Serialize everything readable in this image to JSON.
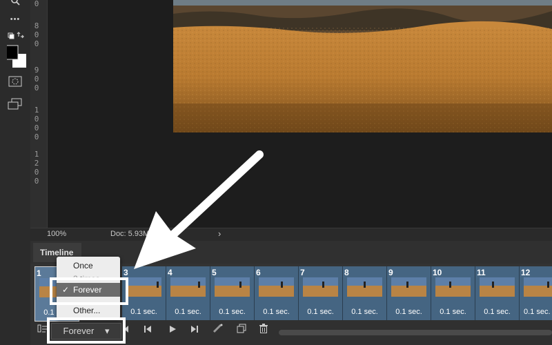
{
  "toolbar": {
    "tools": [
      {
        "icon": "zoom-icon"
      },
      {
        "icon": "more-tools-icon",
        "glyph": "•••"
      },
      {
        "icon": "swap-colors-icon"
      },
      {
        "icon": "color-swatches-icon"
      },
      {
        "icon": "quick-mask-icon"
      },
      {
        "icon": "screen-mode-icon"
      }
    ]
  },
  "ruler": {
    "digits": [
      "0",
      "8",
      "0",
      "0",
      "9",
      "0",
      "0",
      "1",
      "0",
      "0",
      "0",
      "1",
      "2",
      "0",
      "0"
    ]
  },
  "status": {
    "zoom": "100%",
    "doc": "Doc: 5.93M/5.93M",
    "arrow": "›"
  },
  "timeline": {
    "tab_label": "Timeline",
    "frames": [
      {
        "number": "1",
        "duration": "0.1 sec."
      },
      {
        "number": "3",
        "duration": "0.1 sec."
      },
      {
        "number": "4",
        "duration": "0.1 sec."
      },
      {
        "number": "5",
        "duration": "0.1 sec."
      },
      {
        "number": "6",
        "duration": "0.1 sec."
      },
      {
        "number": "7",
        "duration": "0.1 sec."
      },
      {
        "number": "8",
        "duration": "0.1 sec."
      },
      {
        "number": "9",
        "duration": "0.1 sec."
      },
      {
        "number": "10",
        "duration": "0.1 sec."
      },
      {
        "number": "11",
        "duration": "0.1 sec."
      },
      {
        "number": "12",
        "duration": "0.1 sec."
      }
    ],
    "loop_select": {
      "value": "Forever",
      "caret": "▾"
    },
    "loop_menu": {
      "options": [
        "Once",
        "3 times",
        "Forever",
        "Other..."
      ],
      "selected": "Forever",
      "check": "✓"
    }
  },
  "colors": {
    "frame": "#456582",
    "highlight": "#ffffff",
    "arrow": "#ffffff"
  }
}
